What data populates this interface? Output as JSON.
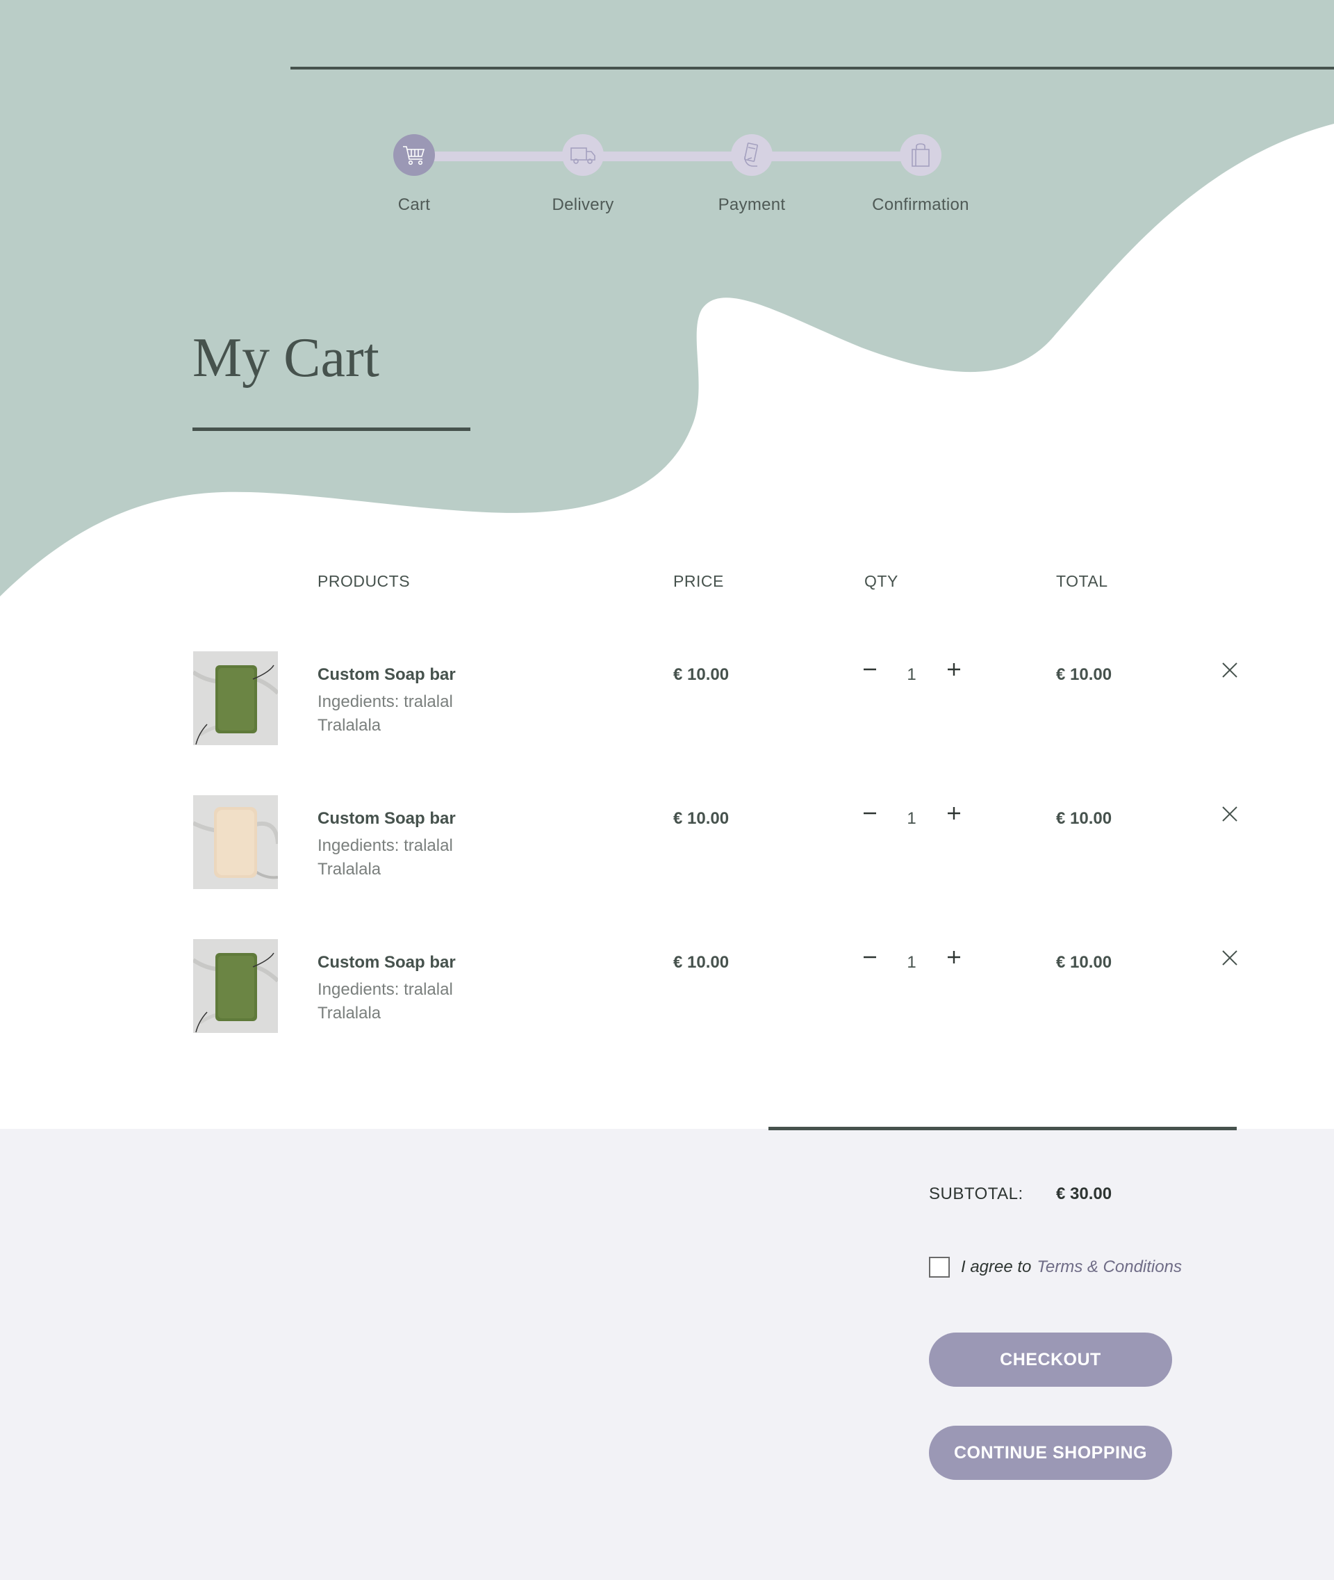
{
  "colors": {
    "sage": "#bacdc7",
    "dark_green": "#46524d",
    "lavender": "#9b98b5",
    "lavender_light": "#d6d2e2",
    "footer_bg": "#f2f2f6"
  },
  "steps": [
    {
      "label": "Cart",
      "icon": "cart-icon",
      "active": true
    },
    {
      "label": "Delivery",
      "icon": "truck-icon",
      "active": false
    },
    {
      "label": "Payment",
      "icon": "card-icon",
      "active": false
    },
    {
      "label": "Confirmation",
      "icon": "bag-icon",
      "active": false
    }
  ],
  "page_title": "My Cart",
  "table": {
    "headers": {
      "products": "PRODUCTS",
      "price": "PRICE",
      "qty": "QTY",
      "total": "TOTAL"
    },
    "rows": [
      {
        "name": "Custom Soap bar",
        "description": "Ingedients: tralalal Tralalala",
        "price": "€ 10.00",
        "qty": "1",
        "total": "€ 10.00",
        "image": "green-soap-image"
      },
      {
        "name": "Custom Soap bar",
        "description": "Ingedients: tralalal Tralalala",
        "price": "€ 10.00",
        "qty": "1",
        "total": "€ 10.00",
        "image": "cream-soap-image"
      },
      {
        "name": "Custom Soap bar",
        "description": "Ingedients: tralalal Tralalala",
        "price": "€ 10.00",
        "qty": "1",
        "total": "€ 10.00",
        "image": "green-soap-image"
      }
    ]
  },
  "summary": {
    "subtotal_label": "SUBTOTAL:",
    "subtotal_value": "€ 30.00",
    "agree_text": "I agree to",
    "terms_link": "Terms & Conditions",
    "checkout_label": "CHECKOUT",
    "continue_label": "CONTINUE SHOPPING"
  }
}
